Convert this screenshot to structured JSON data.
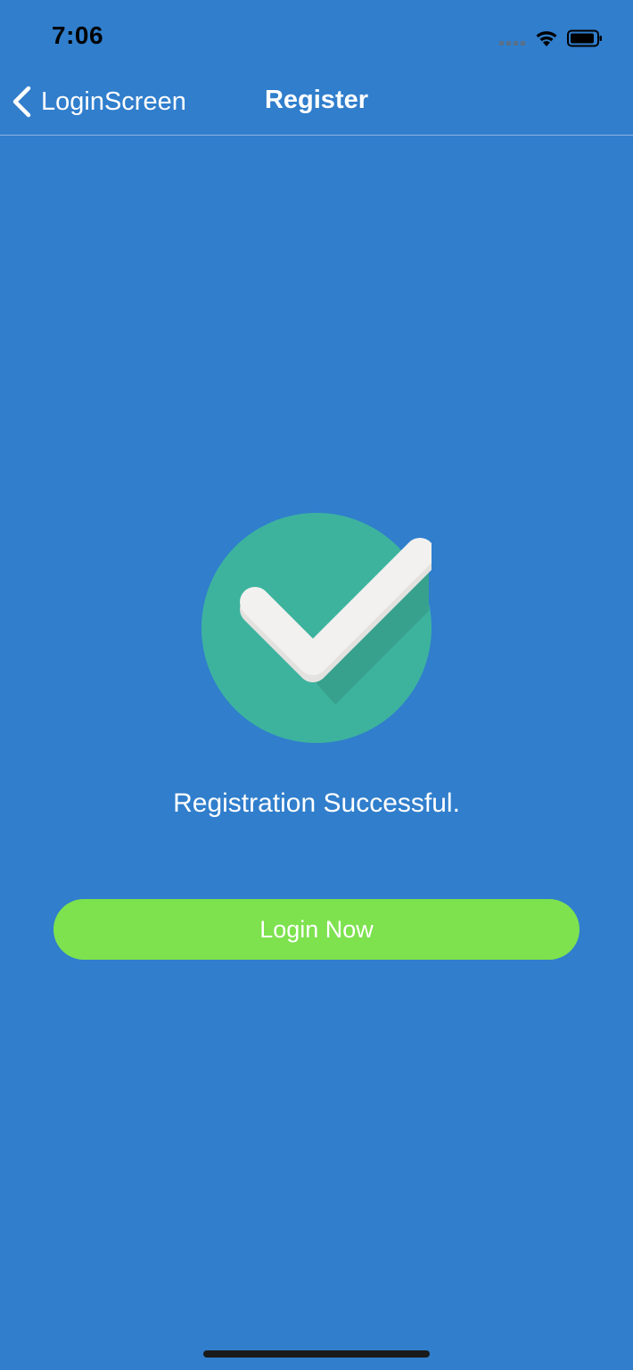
{
  "status_bar": {
    "time": "7:06",
    "icons": [
      "cellular-signal-icon",
      "wifi-icon",
      "battery-icon"
    ]
  },
  "nav": {
    "back_label": "LoginScreen",
    "title": "Register"
  },
  "content": {
    "icon": "checkmark-circle-icon",
    "message": "Registration Successful.",
    "button_label": "Login Now"
  },
  "colors": {
    "background": "#307ECC",
    "button": "#7DE24E",
    "icon_circle": "#3DB39E",
    "checkmark": "#F2F1EF"
  }
}
